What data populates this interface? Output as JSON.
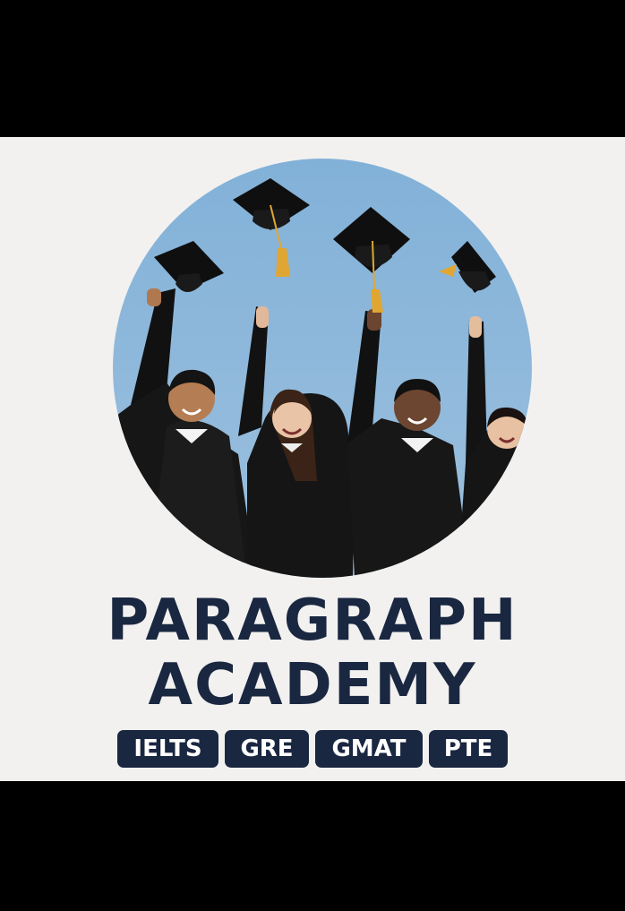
{
  "brand": {
    "title_line1": "PARAGRAPH",
    "title_line2": "ACADEMY"
  },
  "badges": [
    {
      "label": "IELTS"
    },
    {
      "label": "GRE"
    },
    {
      "label": "GMAT"
    },
    {
      "label": "PTE"
    }
  ],
  "colors": {
    "navy": "#1a2741",
    "sky": "#8ab6da",
    "background": "#f2f1ef",
    "tassel": "#e0a633"
  },
  "photo": {
    "subject": "graduates-throwing-caps",
    "graduate_count": 4,
    "caps_in_air": 4
  }
}
